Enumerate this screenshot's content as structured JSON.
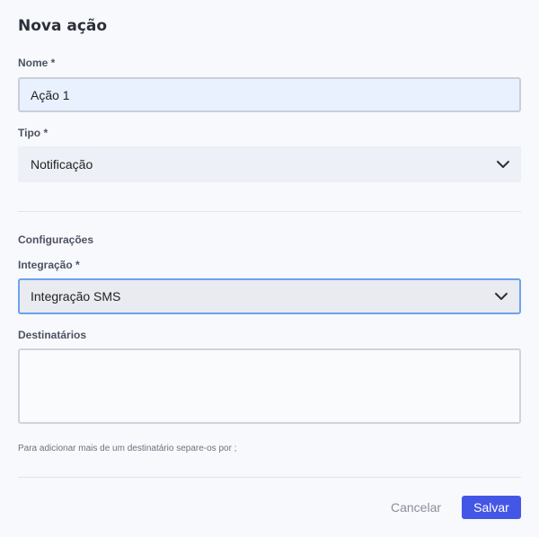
{
  "dialog": {
    "title": "Nova ação"
  },
  "form": {
    "name": {
      "label": "Nome *",
      "value": "Ação 1"
    },
    "type": {
      "label": "Tipo *",
      "value": "Notificação"
    },
    "settings_section": "Configurações",
    "integration": {
      "label": "Integração *",
      "value": "Integração SMS"
    },
    "recipients": {
      "label": "Destinatários",
      "value": "",
      "hint": "Para adicionar mais de um destinatário separe-os por ;"
    }
  },
  "actions": {
    "cancel_label": "Cancelar",
    "save_label": "Salvar"
  },
  "colors": {
    "primary": "#4356e6",
    "focus_border": "#6ea1ef",
    "input_bg": "#e9f0fe"
  },
  "icons": {
    "select_chevron": "chevron-down-icon"
  }
}
